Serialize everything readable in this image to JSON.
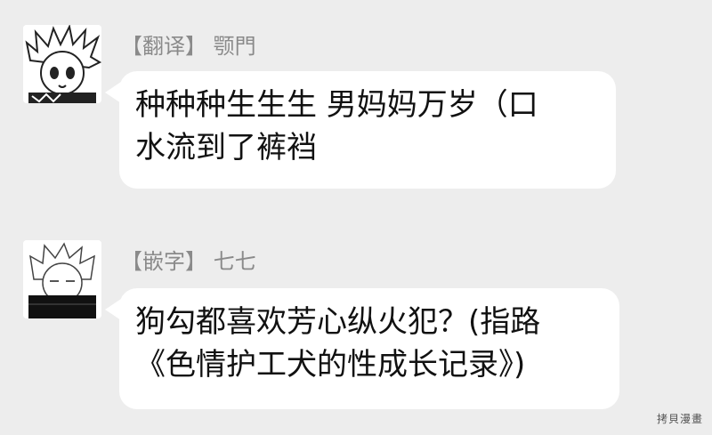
{
  "messages": [
    {
      "sender": "【翻译】 颚門",
      "avatar_icon": "anime-avatar-spiky-hair-icon",
      "lines": [
        "种种种生生生 男妈妈万岁（口",
        "水流到了裤裆"
      ]
    },
    {
      "sender": "【嵌字】 七七",
      "avatar_icon": "anime-avatar-white-hair-icon",
      "lines": [
        "狗勾都喜欢芳心纵火犯？(指路",
        "《色情护工犬的性成长记录》)"
      ]
    }
  ],
  "watermark": "拷貝漫畫",
  "colors": {
    "background": "#ededed",
    "bubble": "#ffffff",
    "sender": "#8a8a8a"
  }
}
